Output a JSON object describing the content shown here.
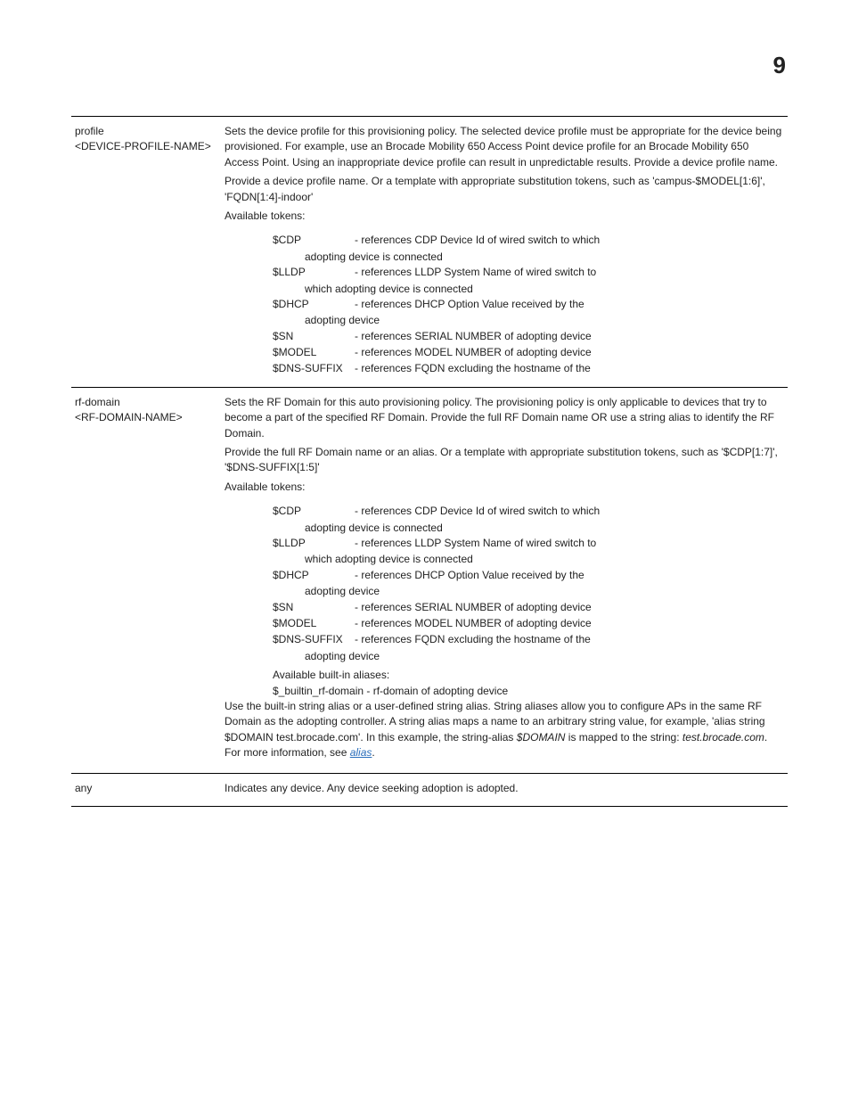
{
  "pageNumber": "9",
  "rows": {
    "profile": {
      "param1": "profile",
      "param2": "<DEVICE-PROFILE-NAME>",
      "p1": "Sets the device profile for this provisioning policy. The selected device profile must be appropriate for the device being provisioned. For example, use an Brocade Mobility 650 Access Point device profile for an Brocade Mobility 650 Access Point. Using an inappropriate device profile can result in unpredictable results. Provide a device profile name.",
      "p2": "Provide a device profile name. Or a template with appropriate substitution tokens, such as 'campus-$MODEL[1:6]', 'FQDN[1:4]-indoor'",
      "p3": "Available tokens:",
      "tokens": {
        "cdp": {
          "name": "$CDP",
          "d1": "- references CDP Device Id of wired switch to which",
          "d2": "adopting device is connected"
        },
        "lldp": {
          "name": "$LLDP",
          "d1": "- references LLDP System Name of wired switch to",
          "d2": "which adopting device is connected"
        },
        "dhcp": {
          "name": "$DHCP",
          "d1": "- references DHCP Option Value received by the",
          "d2": "adopting device"
        },
        "sn": {
          "name": "$SN",
          "d1": "- references SERIAL NUMBER of adopting device"
        },
        "model": {
          "name": "$MODEL",
          "d1": "- references MODEL NUMBER of adopting device"
        },
        "dns": {
          "name": "$DNS-SUFFIX",
          "d1": "- references FQDN excluding the hostname of the"
        }
      }
    },
    "rfdomain": {
      "param1": "rf-domain",
      "param2": "<RF-DOMAIN-NAME>",
      "p1": "Sets the RF Domain for this auto provisioning policy. The provisioning policy is only applicable to devices that try to become a part of the specified RF Domain. Provide the full RF Domain name OR use a string alias to identify the RF Domain.",
      "p2": "Provide the full RF Domain name or an alias. Or a template with appropriate substitution tokens, such as '$CDP[1:7]', '$DNS-SUFFIX[1:5]'",
      "p3": "Available tokens:",
      "tokens": {
        "cdp": {
          "name": "$CDP",
          "d1": "- references CDP Device Id of wired switch to which",
          "d2": "adopting device is connected"
        },
        "lldp": {
          "name": "$LLDP",
          "d1": "- references LLDP System Name of wired switch to",
          "d2": "which adopting device is connected"
        },
        "dhcp": {
          "name": "$DHCP",
          "d1": "- references DHCP Option Value received by the",
          "d2": "adopting device"
        },
        "sn": {
          "name": "$SN",
          "d1": "- references SERIAL NUMBER of adopting device"
        },
        "model": {
          "name": "$MODEL",
          "d1": "- references MODEL NUMBER of adopting device"
        },
        "dns": {
          "name": "$DNS-SUFFIX",
          "d1": "- references FQDN excluding the hostname of the",
          "d2": "adopting device"
        }
      },
      "aliasesHeader": "Available built-in aliases:",
      "aliasesLine": "$_builtin_rf-domain - rf-domain of adopting device",
      "p4a": "Use the built-in string alias or a user-defined string alias. String aliases allow you to configure APs in the same RF Domain as the adopting controller. A string alias maps a name to an arbitrary string value, for example, 'alias string $DOMAIN test.brocade.com'. In this example, the string-alias ",
      "p4b": "$DOMAIN",
      "p4c": " is mapped to the string: ",
      "p4d": "test.brocade.com",
      "p4e": ". For more information, see ",
      "p4f": "alias",
      "p4g": "."
    },
    "any": {
      "param": "any",
      "desc": "Indicates any device. Any device seeking adoption is adopted."
    }
  }
}
